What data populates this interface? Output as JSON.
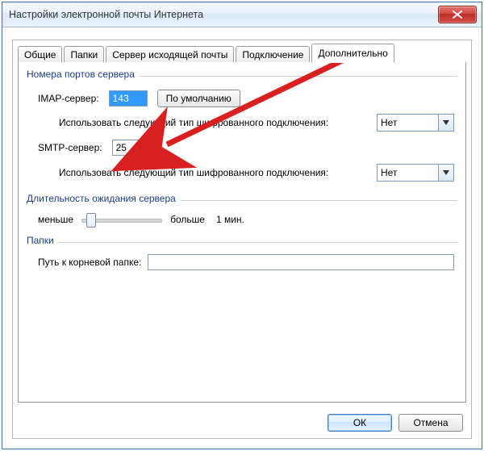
{
  "window": {
    "title": "Настройки электронной почты Интернета"
  },
  "tabs": {
    "general": "Общие",
    "folders": "Папки",
    "outgoing": "Сервер исходящей почты",
    "connection": "Подключение",
    "advanced": "Дополнительно"
  },
  "ports_group": {
    "legend": "Номера портов сервера",
    "imap_label": "IMAP-сервер:",
    "imap_value": "143",
    "defaults_btn": "По умолчанию",
    "enc_label1": "Использовать следующий тип шифрованного подключения:",
    "enc_value1": "Нет",
    "smtp_label": "SMTP-сервер:",
    "smtp_value": "25",
    "enc_label2": "Использовать следующий тип шифрованного подключения:",
    "enc_value2": "Нет"
  },
  "timeout_group": {
    "legend": "Длительность ожидания сервера",
    "less": "меньше",
    "more": "больше",
    "value": "1 мин."
  },
  "folders_group": {
    "legend": "Папки",
    "root_label": "Путь к корневой папке:",
    "root_value": ""
  },
  "buttons": {
    "ok": "ОК",
    "cancel": "Отмена"
  }
}
